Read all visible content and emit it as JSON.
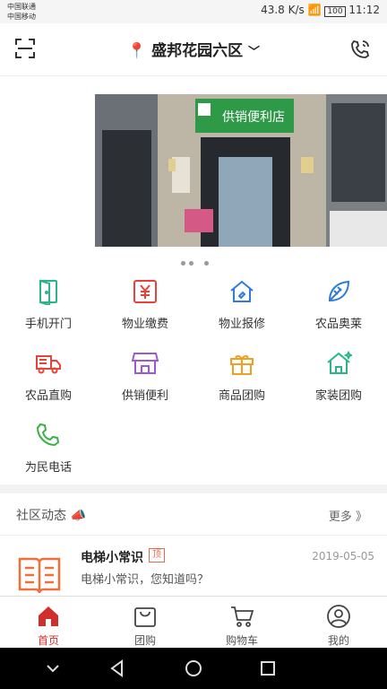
{
  "status": {
    "carrier1": "中国联通",
    "carrier2": "中国移动",
    "speed": "43.8 K/s",
    "battery": "100",
    "time": "11:12"
  },
  "header": {
    "location": "盛邦花园六区"
  },
  "banner": {
    "store_sign": "供销便利店"
  },
  "services": [
    {
      "label": "手机开门",
      "icon": "door-icon"
    },
    {
      "label": "物业缴费",
      "icon": "yen-icon"
    },
    {
      "label": "物业报修",
      "icon": "repair-house-icon"
    },
    {
      "label": "农品奥莱",
      "icon": "leaf-icon"
    },
    {
      "label": "农品直购",
      "icon": "truck-icon"
    },
    {
      "label": "供销便利",
      "icon": "store-icon"
    },
    {
      "label": "商品团购",
      "icon": "gift-icon"
    },
    {
      "label": "家装团购",
      "icon": "home-icon"
    },
    {
      "label": "为民电话",
      "icon": "phone-icon"
    }
  ],
  "news": {
    "section_title": "社区动态",
    "more": "更多 》",
    "items": [
      {
        "title": "电梯小常识",
        "tag": "顶",
        "desc": "电梯小常识，您知道吗？",
        "date": "2019-05-05"
      }
    ]
  },
  "tabs": [
    {
      "label": "首页",
      "active": true
    },
    {
      "label": "团购"
    },
    {
      "label": "购物车"
    },
    {
      "label": "我的"
    }
  ],
  "colors": {
    "accent": "#d0302b"
  }
}
